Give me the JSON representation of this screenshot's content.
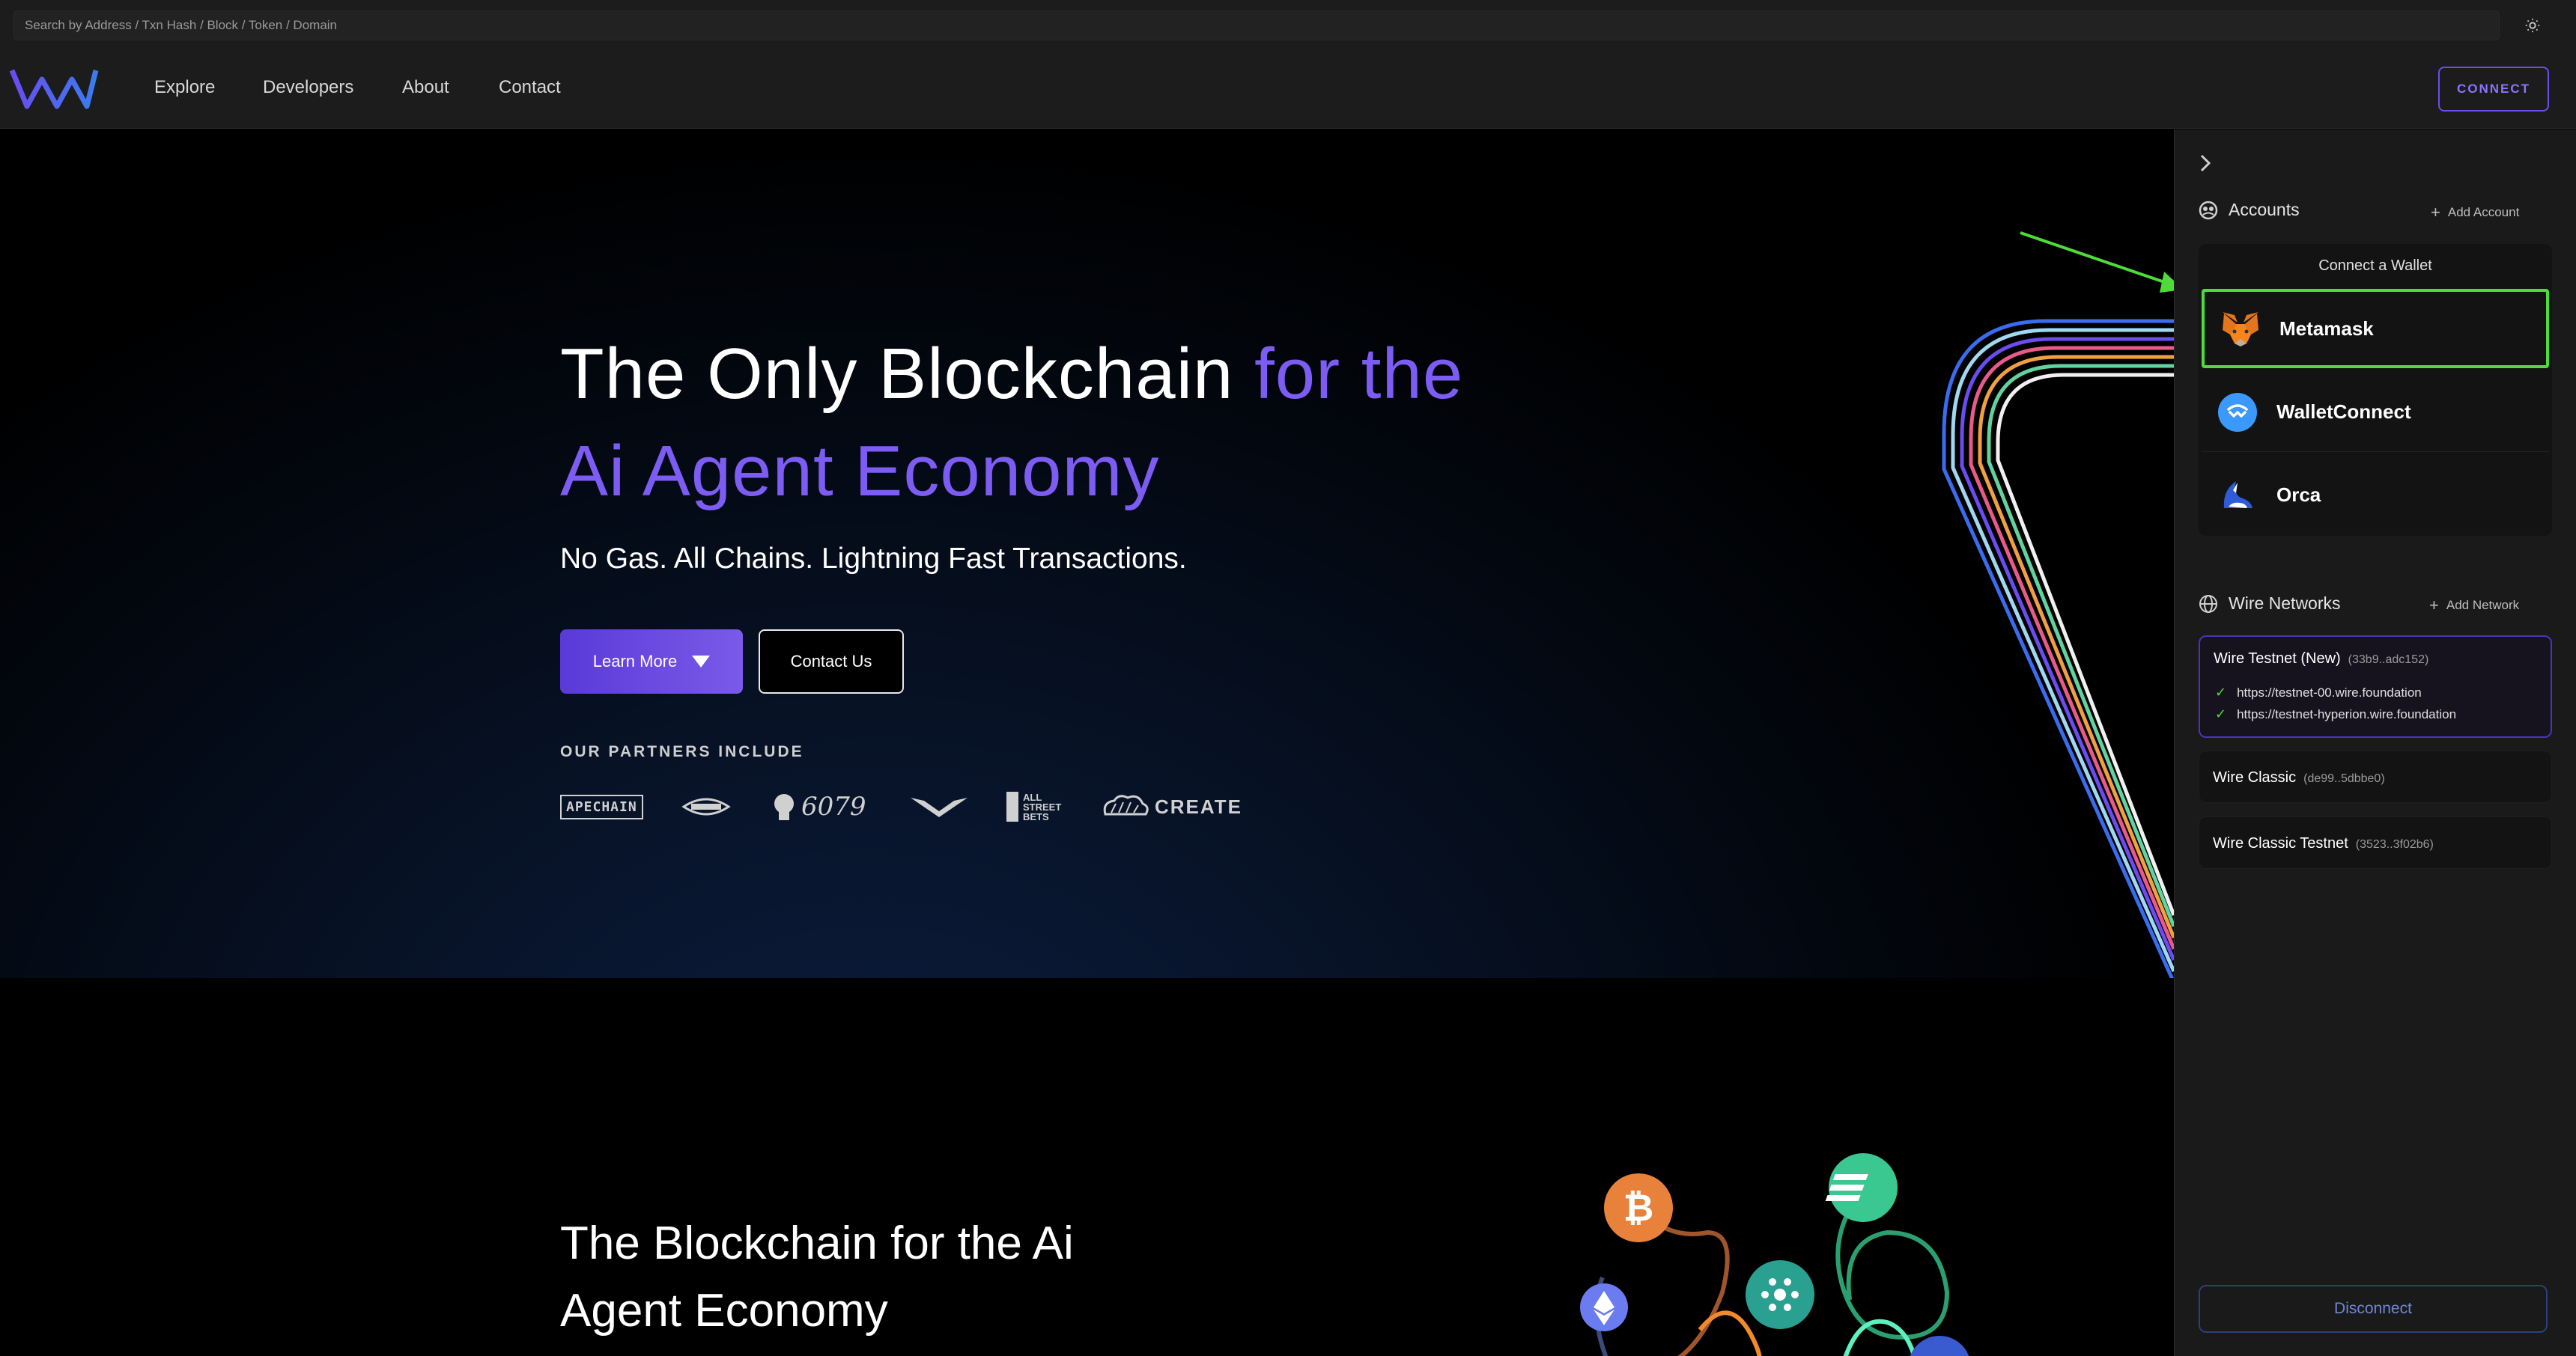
{
  "search": {
    "placeholder": "Search by Address / Txn Hash / Block / Token / Domain"
  },
  "nav": {
    "items": [
      {
        "label": "Explore"
      },
      {
        "label": "Developers"
      },
      {
        "label": "About"
      },
      {
        "label": "Contact"
      }
    ],
    "connect_label": "CONNECT"
  },
  "hero": {
    "title_part1": "The Only Blockchain ",
    "title_accent1": "for the",
    "title_accent2": "Ai Agent Economy",
    "subtitle": "No Gas. All Chains. Lightning Fast Transactions.",
    "learn_more_label": "Learn More",
    "contact_label": "Contact Us",
    "partners_label": "OUR PARTNERS INCLUDE",
    "partners": [
      "APECHAIN",
      "6079",
      "ALL STREET BETS",
      "CREATE"
    ]
  },
  "section2": {
    "title": "The Blockchain for the Ai Agent Economy"
  },
  "panel": {
    "accounts_label": "Accounts",
    "add_account_label": "Add Account",
    "connect_wallet_label": "Connect a Wallet",
    "wallets": [
      {
        "label": "Metamask",
        "icon": "metamask-fox-icon"
      },
      {
        "label": "WalletConnect",
        "icon": "walletconnect-icon"
      },
      {
        "label": "Orca",
        "icon": "orca-icon"
      }
    ],
    "networks_label": "Wire Networks",
    "add_network_label": "Add Network",
    "networks": [
      {
        "name": "Wire Testnet (New)",
        "hash": "(33b9..adc152)",
        "endpoints": [
          "https://testnet-00.wire.foundation",
          "https://testnet-hyperion.wire.foundation"
        ]
      },
      {
        "name": "Wire Classic",
        "hash": "(de99..5dbbe0)"
      },
      {
        "name": "Wire Classic Testnet",
        "hash": "(3523..3f02b6)"
      }
    ],
    "disconnect_label": "Disconnect"
  },
  "colors": {
    "accent": "#7c5cf2",
    "highlight": "#4fdc3a",
    "panel_bg": "#1a1a1a"
  }
}
